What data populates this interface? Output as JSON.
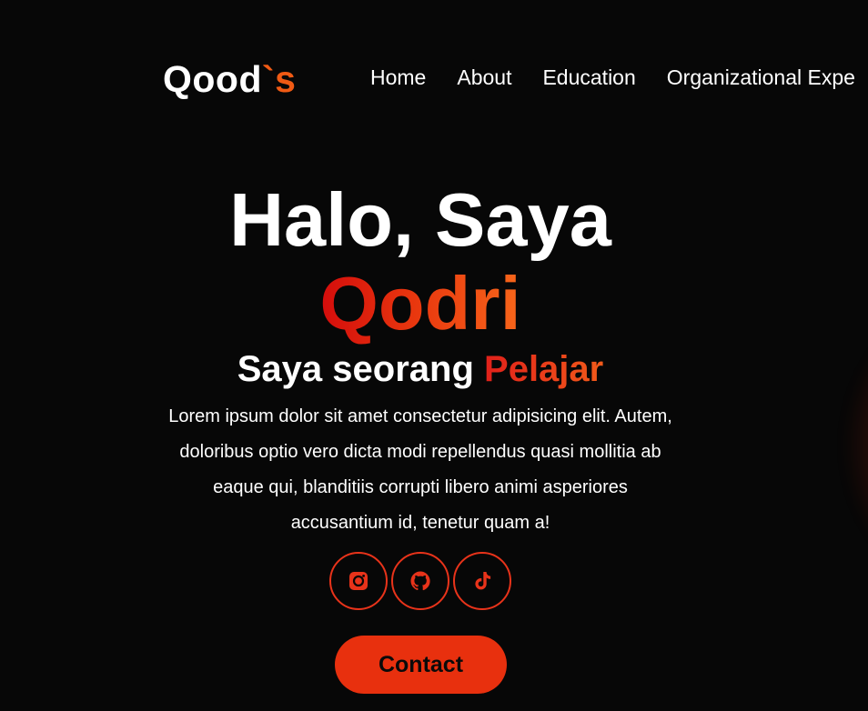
{
  "header": {
    "logo_main": "Qood",
    "logo_accent": "`s",
    "nav": [
      {
        "label": "Home"
      },
      {
        "label": "About"
      },
      {
        "label": "Education"
      },
      {
        "label": "Organizational Expe"
      }
    ]
  },
  "hero": {
    "greeting": "Halo, Saya",
    "name": "Qodri",
    "subtitle_prefix": "Saya seorang",
    "subtitle_role": "Pelajar",
    "description": "Lorem ipsum dolor sit amet consectetur adipisicing elit. Autem, doloribus optio vero dicta modi repellendus quasi mollitia ab eaque qui, blanditiis corrupti libero animi asperiores accusantium id, tenetur quam a!"
  },
  "socials": [
    {
      "icon": "instagram-icon"
    },
    {
      "icon": "github-icon"
    },
    {
      "icon": "tiktok-icon"
    }
  ],
  "contact_button": {
    "label": "Contact"
  },
  "colors": {
    "background": "#070707",
    "accent": "#e8300e",
    "accent_light": "#f05a14",
    "text": "#ffffff"
  }
}
